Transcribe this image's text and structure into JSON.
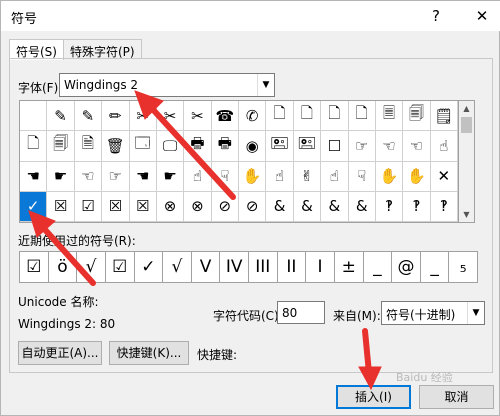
{
  "window": {
    "title": "符号",
    "help_label": "?",
    "close_label": "✕"
  },
  "tabs": [
    {
      "label": "符号(S)",
      "active": true
    },
    {
      "label": "特殊字符(P)",
      "active": false
    }
  ],
  "font": {
    "label": "字体(F):",
    "value": "Wingdings 2"
  },
  "symbol_grid": {
    "rows": [
      [
        "",
        "✎",
        "✎",
        "✏",
        "✂",
        "✂",
        "✂",
        "☎",
        "✆",
        "🗋",
        "🗋",
        "🗋",
        "🗋",
        "🗏",
        "🗐",
        "🗒"
      ],
      [
        "🗋",
        "🗐",
        "🗎",
        "🗑",
        "🗔",
        "🖵",
        "🖶",
        "🖶",
        "◉",
        "🖭",
        "🖭",
        "☐",
        "☞",
        "☜",
        "☜",
        "☝"
      ],
      [
        "☚",
        "☛",
        "☜",
        "☞",
        "☚",
        "☛",
        "☝",
        "☟",
        "✋",
        "☝",
        "✌",
        "☝",
        "☟",
        "✋",
        "✋",
        "✕"
      ],
      [
        "✓",
        "☒",
        "☑",
        "☒",
        "☒",
        "⊗",
        "⊗",
        "⊘",
        "⊘",
        "&",
        "&",
        "&",
        "&",
        "‽",
        "‽",
        "‽"
      ]
    ],
    "selected": {
      "row": 3,
      "col": 0
    }
  },
  "recent": {
    "label": "近期使用过的符号(R):",
    "items": [
      "☑",
      "ö",
      "√",
      "☑",
      "✓",
      "√",
      "V",
      "IV",
      "III",
      "II",
      "I",
      "±",
      "_",
      "@",
      "_",
      "₅"
    ]
  },
  "unicode": {
    "label": "Unicode 名称:",
    "value": "Wingdings 2: 80"
  },
  "char_code": {
    "label": "字符代码(C):",
    "value": "80"
  },
  "from": {
    "label": "来自(M):",
    "value": "符号(十进制)"
  },
  "buttons": {
    "autocorrect": "自动更正(A)...",
    "shortcut_key": "快捷键(K)...",
    "shortcut_label": "快捷键:",
    "insert": "插入(I)",
    "cancel": "取消"
  },
  "watermark": "Baidu 经验"
}
